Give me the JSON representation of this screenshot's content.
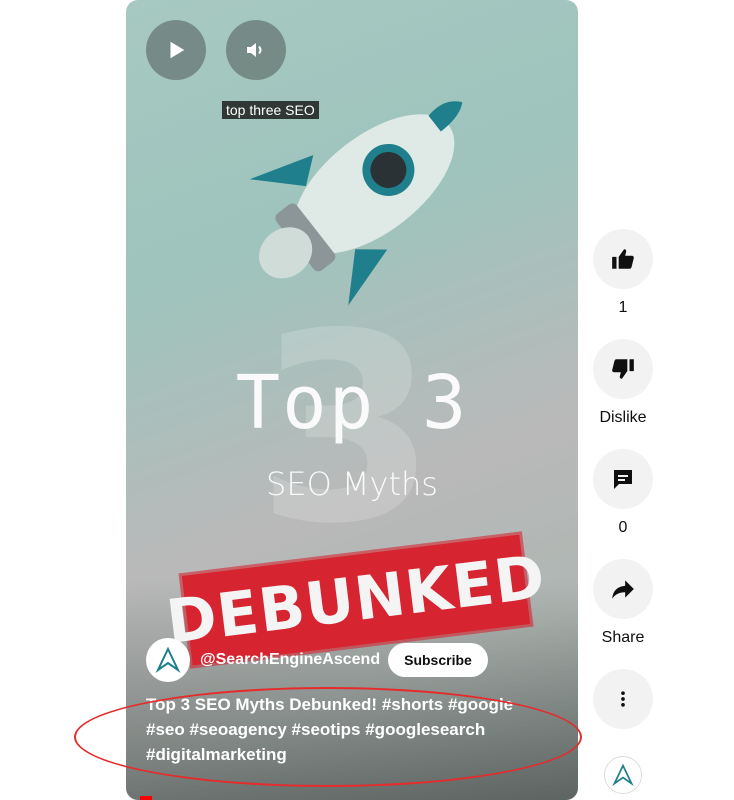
{
  "caption": "top three SEO",
  "video_text": {
    "headline": "Top 3",
    "subheadline": "SEO Myths",
    "stamp": "DEBUNKED"
  },
  "channel": {
    "handle": "@SearchEngineAscend",
    "subscribe_label": "Subscribe"
  },
  "video_title": "Top 3 SEO Myths Debunked! #shorts #google #seo #seoagency #seotips #googlesearch #digitalmarketing",
  "actions": {
    "like_count": "1",
    "dislike_label": "Dislike",
    "comment_count": "0",
    "share_label": "Share"
  },
  "colors": {
    "accent_red": "#ff0000",
    "annotation_oval": "#e52b2b",
    "stamp_red": "#d62430",
    "rocket_teal": "#1f7f8c"
  }
}
